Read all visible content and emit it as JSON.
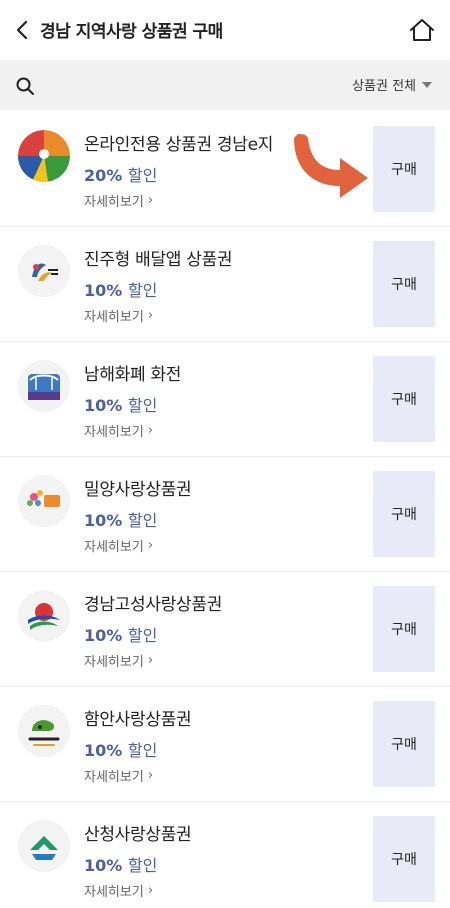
{
  "header": {
    "title": "경남 지역사랑 상품권 구매",
    "back_icon": "chevron-left-icon",
    "home_icon": "home-icon"
  },
  "search": {
    "icon": "search-icon",
    "filter_label": "상품권 전체"
  },
  "items": [
    {
      "name": "온라인전용 상품권 경남e지",
      "discount_value": "20%",
      "discount_word": "할인",
      "detail": "자세히보기",
      "buy": "구매"
    },
    {
      "name": "진주형 배달앱 상품권",
      "discount_value": "10%",
      "discount_word": "할인",
      "detail": "자세히보기",
      "buy": "구매"
    },
    {
      "name": "남해화폐 화전",
      "discount_value": "10%",
      "discount_word": "할인",
      "detail": "자세히보기",
      "buy": "구매"
    },
    {
      "name": "밀양사랑상품권",
      "discount_value": "10%",
      "discount_word": "할인",
      "detail": "자세히보기",
      "buy": "구매"
    },
    {
      "name": "경남고성사랑상품권",
      "discount_value": "10%",
      "discount_word": "할인",
      "detail": "자세히보기",
      "buy": "구매"
    },
    {
      "name": "함안사랑상품권",
      "discount_value": "10%",
      "discount_word": "할인",
      "detail": "자세히보기",
      "buy": "구매"
    },
    {
      "name": "산청사랑상품권",
      "discount_value": "10%",
      "discount_word": "할인",
      "detail": "자세히보기",
      "buy": "구매"
    }
  ],
  "colors": {
    "accent": "#4a5fa8",
    "button_bg": "#e8eaf7",
    "annotation_arrow": "#e0633e"
  }
}
